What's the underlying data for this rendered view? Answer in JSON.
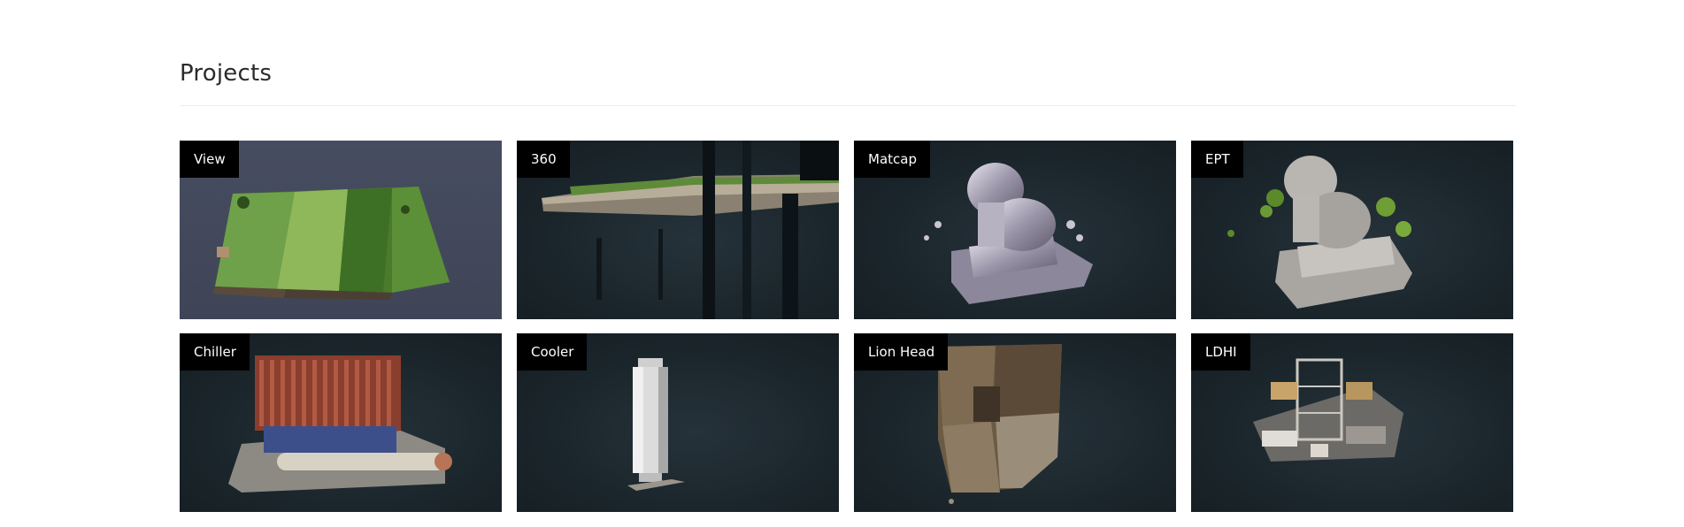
{
  "page": {
    "title": "Projects"
  },
  "projects": [
    {
      "label": "View",
      "thumbnail": "terrain-point-cloud"
    },
    {
      "label": "360",
      "thumbnail": "panorama-point-cloud"
    },
    {
      "label": "Matcap",
      "thumbnail": "lion-statue-matcap"
    },
    {
      "label": "EPT",
      "thumbnail": "lion-statue-ept"
    },
    {
      "label": "Chiller",
      "thumbnail": "chiller-point-cloud"
    },
    {
      "label": "Cooler",
      "thumbnail": "cooler-point-cloud"
    },
    {
      "label": "Lion Head",
      "thumbnail": "lion-head-point-cloud"
    },
    {
      "label": "LDHI",
      "thumbnail": "ldhi-point-cloud"
    }
  ],
  "colors": {
    "label_bg": "#000000",
    "label_text": "#ffffff",
    "card_bg": "#1b262c",
    "view_card_bg": "#454b5e"
  }
}
